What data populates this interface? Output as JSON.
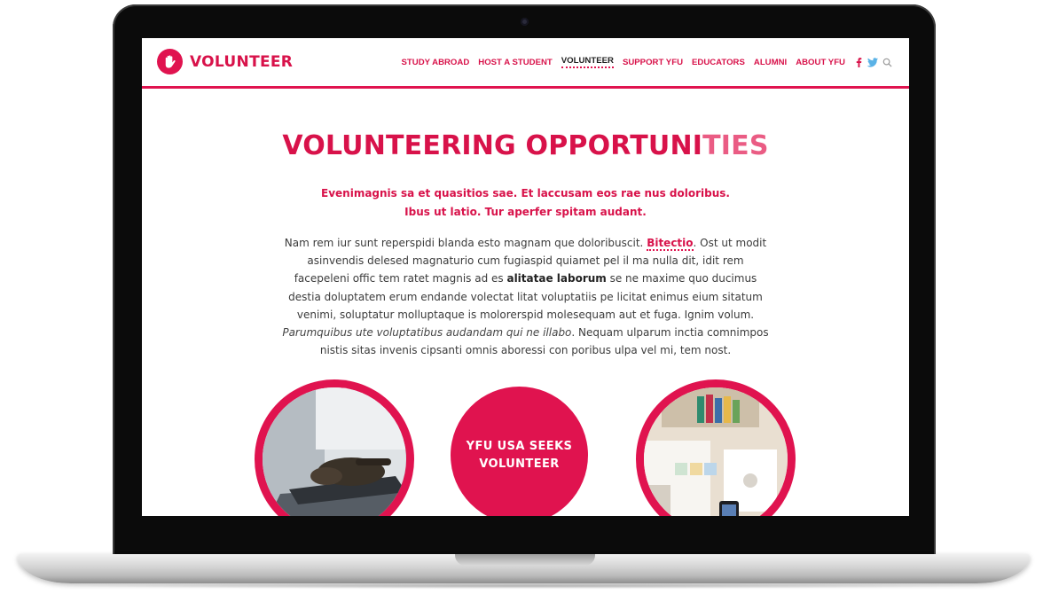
{
  "site": {
    "logo_text": "VOLUNTEER"
  },
  "nav": {
    "items": [
      "STUDY ABROAD",
      "HOST A STUDENT",
      "VOLUNTEER",
      "SUPPORT YFU",
      "EDUCATORS",
      "ALUMNI",
      "ABOUT YFU"
    ],
    "active_index": 2,
    "social_icons": [
      "facebook-icon",
      "twitter-icon",
      "search-icon"
    ]
  },
  "hero": {
    "title_main": "VOLUNTEERING OPPORTUNI",
    "title_fade": "TIES",
    "intro_line1": "Evenimagnis sa et quasitios sae. Et laccusam eos rae nus doloribus.",
    "intro_line2": "Ibus ut latio. Tur aperfer spitam audant."
  },
  "body": {
    "part1": "Nam rem iur sunt reperspidi blanda esto magnam que doloribuscit. ",
    "link": "Bitectio",
    "part2": ". Ost ut modit asinvendis delesed magnaturio cum fugiaspid quiamet pel il ma nulla dit, idit rem facepeleni offic tem ratet magnis ad es ",
    "bold": "alitatae laborum",
    "part3": " se ne maxime quo ducimus destia doluptatem erum endande volectat litat voluptatiis pe licitat enimus eium sitatum venimi, soluptatur molluptaque is molorerspid molesequam aut et fuga. Ignim volum. ",
    "italic": "Parumquibus ute voluptatibus audandam qui ne illabo",
    "part4": ". Nequam ulparum inctia comnimpos nistis sitas invenis cipsanti omnis aboressi con poribus ulpa vel mi, tem nost."
  },
  "circles": {
    "center_label": "YFU USA SEEKS VOLUNTEER"
  },
  "colors": {
    "brand": "#e0134f",
    "text": "#3b3b3b"
  }
}
